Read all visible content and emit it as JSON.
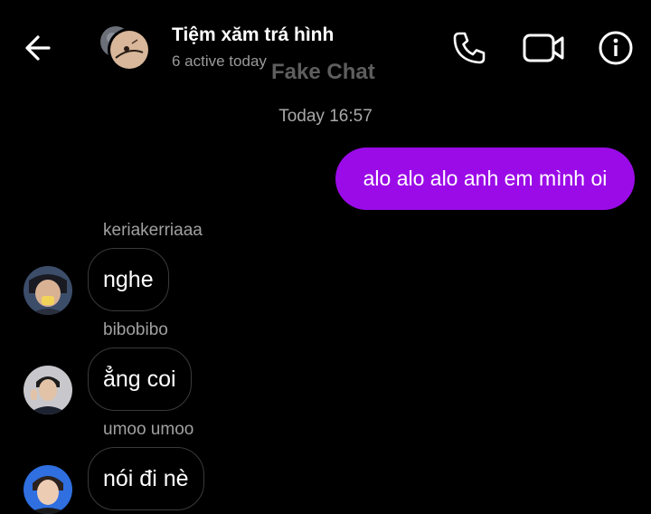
{
  "header": {
    "title": "Tiệm xăm trá hình",
    "status": "6 active today",
    "watermark": "Fake Chat",
    "back_icon": "arrow-left-icon",
    "call_icon": "phone-icon",
    "video_icon": "video-camera-icon",
    "info_icon": "info-circle-icon"
  },
  "chat": {
    "timestamp": "Today 16:57",
    "outgoing": {
      "text": "alo alo alo anh em mình oi",
      "color": "#9b0be8"
    },
    "incoming": [
      {
        "sender": "keriakerriaaa",
        "text": "nghe"
      },
      {
        "sender": "bibobibo",
        "text": "ẳng coi"
      },
      {
        "sender": "umoo umoo",
        "text": "nói đi nè"
      }
    ]
  },
  "colors": {
    "background": "#000000",
    "secondary_text": "#a0a0a0",
    "bubble_border": "#3a3a3a"
  }
}
